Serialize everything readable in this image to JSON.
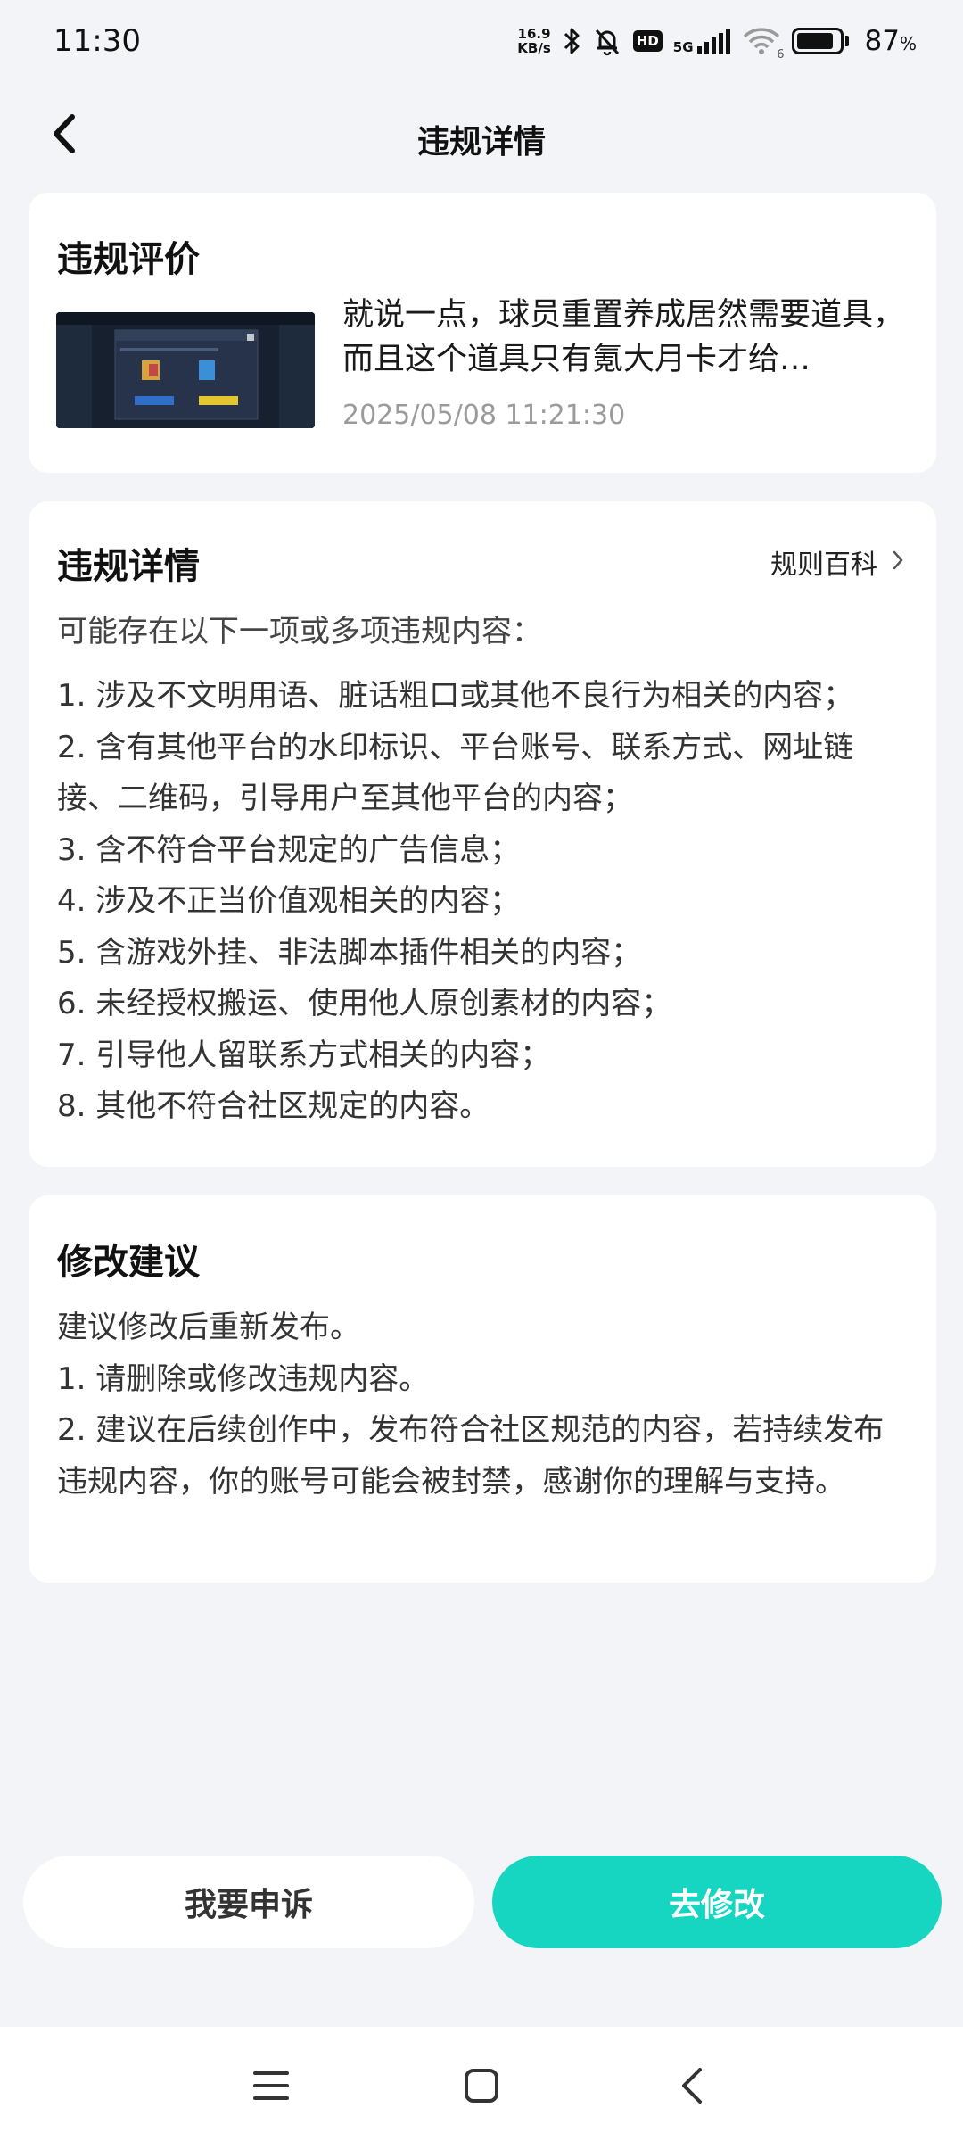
{
  "status_bar": {
    "time": "11:30",
    "net_speed_value": "16.9",
    "net_speed_unit": "KB/s",
    "network_type": "5G",
    "hd_label": "HD",
    "wifi_badge": "6",
    "battery_percent": "87",
    "battery_unit": "%",
    "battery_level": 0.87,
    "icons": [
      "bluetooth-icon",
      "mute-bell-icon",
      "hd-icon",
      "signal-icon",
      "wifi-icon",
      "battery-icon"
    ]
  },
  "header": {
    "title": "违规详情",
    "back_icon": "back-chevron-icon"
  },
  "evaluation": {
    "title": "违规评价",
    "post_text": "就说一点，球员重置养成居然需要道具，而且这个道具只有氪大月卡才给…",
    "post_time": "2025/05/08 11:21:30"
  },
  "details": {
    "title": "违规详情",
    "rules_link": "规则百科",
    "intro": "可能存在以下一项或多项违规内容：",
    "items": [
      "1. 涉及不文明用语、脏话粗口或其他不良行为相关的内容；",
      "2. 含有其他平台的水印标识、平台账号、联系方式、网址链接、二维码，引导用户至其他平台的内容；",
      "3. 含不符合平台规定的广告信息；",
      "4. 涉及不正当价值观相关的内容；",
      "5. 含游戏外挂、非法脚本插件相关的内容；",
      "6. 未经授权搬运、使用他人原创素材的内容；",
      "7. 引导他人留联系方式相关的内容；",
      "8. 其他不符合社区规定的内容。"
    ]
  },
  "suggestion": {
    "title": "修改建议",
    "lines": [
      "建议修改后重新发布。",
      "1. 请删除或修改违规内容。",
      "2. 建议在后续创作中，发布符合社区规范的内容，若持续发布违规内容，你的账号可能会被封禁，感谢你的理解与支持。"
    ]
  },
  "actions": {
    "appeal_label": "我要申诉",
    "edit_label": "去修改"
  },
  "colors": {
    "accent": "#16d6c2",
    "background": "#f3f4f7",
    "card": "#ffffff",
    "muted_text": "#9b9b9b"
  },
  "nav_bar": {
    "icons": [
      "menu-icon",
      "home-square-icon",
      "back-nav-icon"
    ]
  }
}
